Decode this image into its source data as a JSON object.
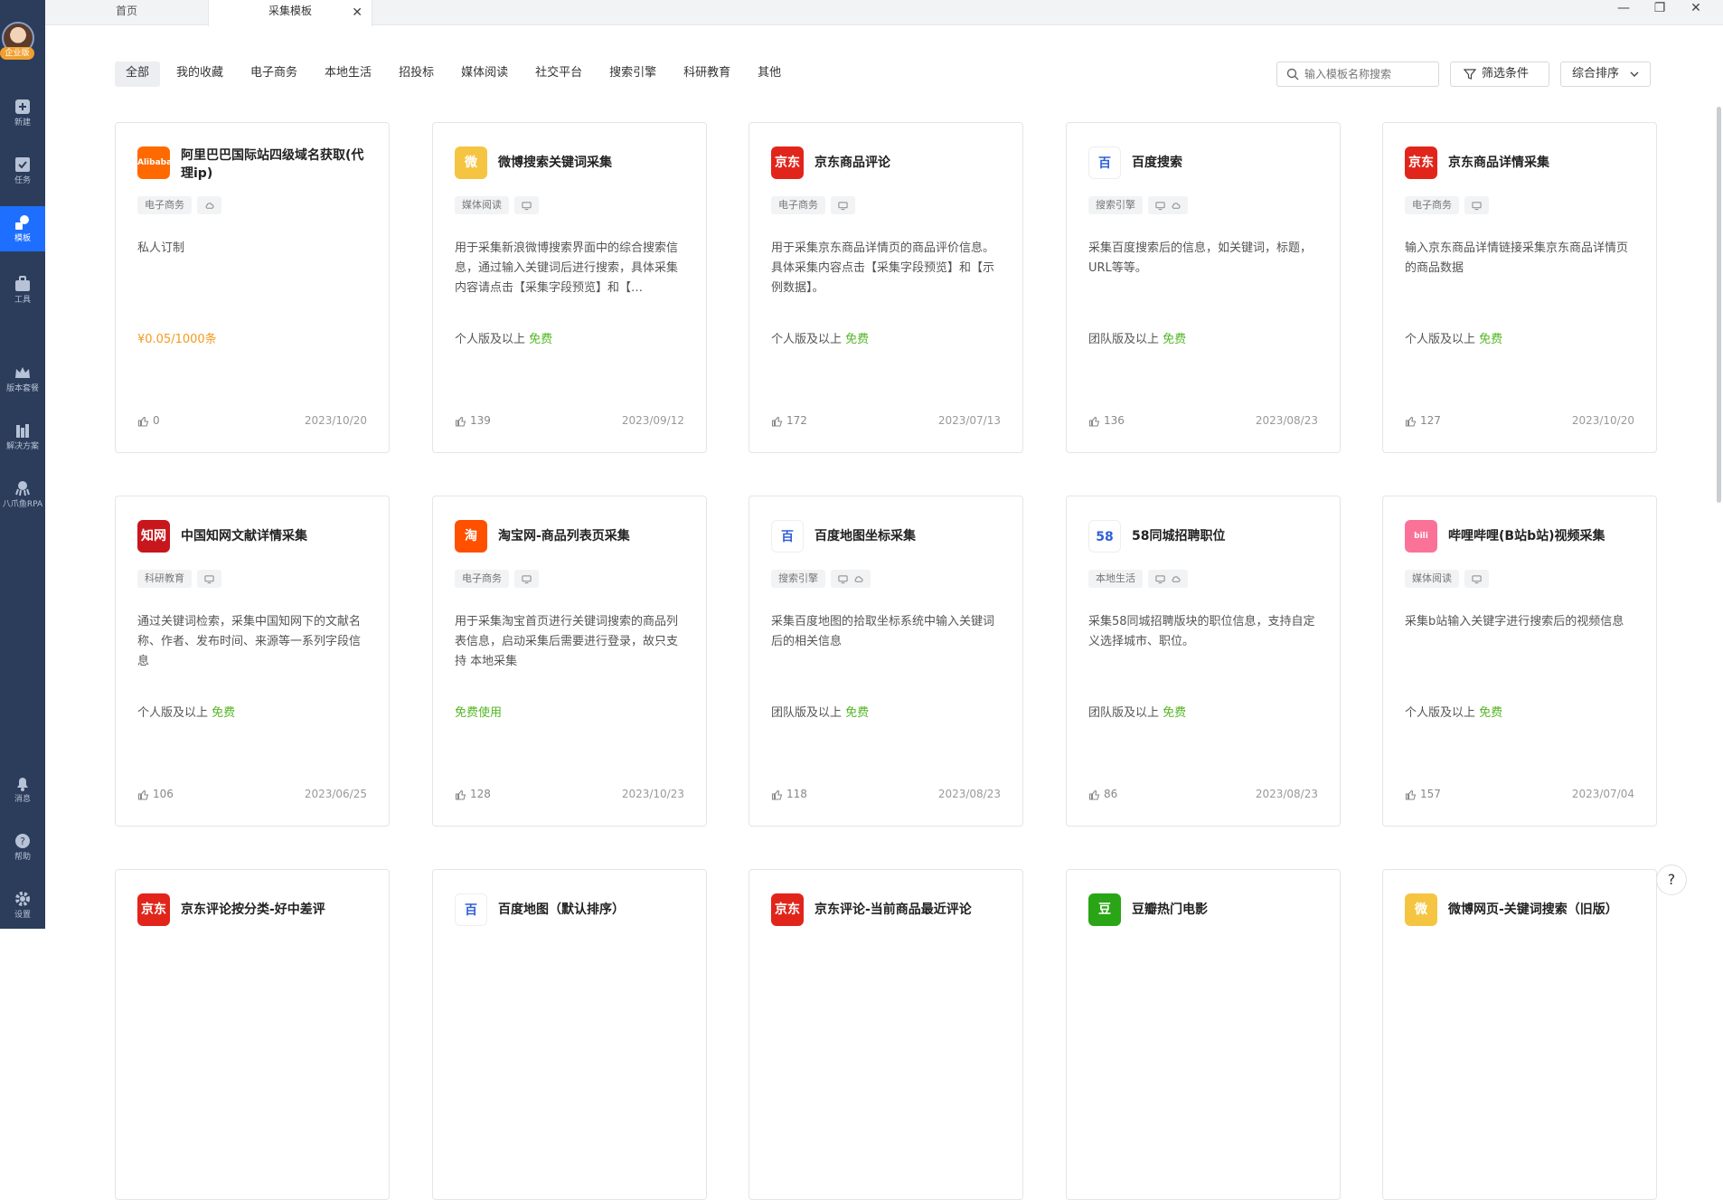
{
  "sidebar": {
    "vip_label": "企业版",
    "items": [
      {
        "label": "新建",
        "icon": "plus-square-icon"
      },
      {
        "label": "任务",
        "icon": "task-check-icon"
      },
      {
        "label": "模板",
        "icon": "template-icon",
        "active": true
      },
      {
        "label": "工具",
        "icon": "toolbox-icon"
      },
      {
        "label": "版本套餐",
        "icon": "crown-icon"
      },
      {
        "label": "解决方案",
        "icon": "solution-icon"
      },
      {
        "label": "八爪鱼RPA",
        "icon": "octopus-icon"
      },
      {
        "label": "消息",
        "icon": "bell-icon"
      },
      {
        "label": "帮助",
        "icon": "help-icon"
      },
      {
        "label": "设置",
        "icon": "gear-icon"
      }
    ]
  },
  "tabs": {
    "home": "首页",
    "active": "采集模板"
  },
  "filters": {
    "categories": [
      "全部",
      "我的收藏",
      "电子商务",
      "本地生活",
      "招投标",
      "媒体阅读",
      "社交平台",
      "搜索引擎",
      "科研教育",
      "其他"
    ],
    "search_placeholder": "输入模板名称搜索",
    "filter_label": "筛选条件",
    "sort_label": "综合排序"
  },
  "colors": {
    "sidebar_bg": "#2b3d5b",
    "accent": "#1e6fff",
    "free_green": "#52b623",
    "price_orange": "#f39a1e"
  },
  "cards": [
    {
      "title": "阿里巴巴国际站四级域名获取(代理ip)",
      "logo_text": "Alibaba",
      "logo_color": "#ff6a00",
      "tag": "电子商务",
      "modes": [
        "cloud"
      ],
      "desc": "私人订制",
      "price_prefix": "¥0.05/1000条",
      "price_free": "",
      "likes": "0",
      "date": "2023/10/20"
    },
    {
      "title": "微博搜索关键词采集",
      "logo_text": "微",
      "logo_color": "#f5c542",
      "tag": "媒体阅读",
      "modes": [
        "local"
      ],
      "desc": "用于采集新浪微博搜索界面中的综合搜索信息，通过输入关键词后进行搜索，具体采集内容请点击【采集字段预览】和【…",
      "price_prefix": "个人版及以上",
      "price_free": "免费",
      "likes": "139",
      "date": "2023/09/12"
    },
    {
      "title": "京东商品评论",
      "logo_text": "京东",
      "logo_color": "#e1251b",
      "tag": "电子商务",
      "modes": [
        "local"
      ],
      "desc": "用于采集京东商品详情页的商品评价信息。具体采集内容点击【采集字段预览】和【示例数据】。",
      "price_prefix": "个人版及以上",
      "price_free": "免费",
      "likes": "172",
      "date": "2023/07/13"
    },
    {
      "title": "百度搜索",
      "logo_text": "百",
      "logo_color": "#ffffff",
      "tag": "搜索引擎",
      "modes": [
        "local",
        "cloud"
      ],
      "desc": "采集百度搜索后的信息，如关键词，标题，URL等等。",
      "price_prefix": "团队版及以上",
      "price_free": "免费",
      "likes": "136",
      "date": "2023/08/23"
    },
    {
      "title": "京东商品详情采集",
      "logo_text": "京东",
      "logo_color": "#e1251b",
      "tag": "电子商务",
      "modes": [
        "local"
      ],
      "desc": "输入京东商品详情链接采集京东商品详情页的商品数据",
      "price_prefix": "个人版及以上",
      "price_free": "免费",
      "likes": "127",
      "date": "2023/10/20"
    },
    {
      "title": "中国知网文献详情采集",
      "logo_text": "知网",
      "logo_color": "#c8161d",
      "tag": "科研教育",
      "modes": [
        "local"
      ],
      "desc": "通过关键词检索，采集中国知网下的文献名称、作者、发布时间、来源等一系列字段信息",
      "price_prefix": "个人版及以上",
      "price_free": "免费",
      "likes": "106",
      "date": "2023/06/25"
    },
    {
      "title": "淘宝网-商品列表页采集",
      "logo_text": "淘",
      "logo_color": "#ff5000",
      "tag": "电子商务",
      "modes": [
        "local"
      ],
      "desc": "用于采集淘宝首页进行关键词搜索的商品列表信息，启动采集后需要进行登录，故只支持 本地采集",
      "price_prefix": "",
      "price_free": "免费使用",
      "likes": "128",
      "date": "2023/10/23"
    },
    {
      "title": "百度地图坐标采集",
      "logo_text": "百",
      "logo_color": "#ffffff",
      "tag": "搜索引擎",
      "modes": [
        "local",
        "cloud"
      ],
      "desc": "采集百度地图的拾取坐标系统中输入关键词后的相关信息",
      "price_prefix": "团队版及以上",
      "price_free": "免费",
      "likes": "118",
      "date": "2023/08/23"
    },
    {
      "title": "58同城招聘职位",
      "logo_text": "58",
      "logo_color": "#ffffff",
      "tag": "本地生活",
      "modes": [
        "local",
        "cloud"
      ],
      "desc": "采集58同城招聘版块的职位信息，支持自定义选择城市、职位。",
      "price_prefix": "团队版及以上",
      "price_free": "免费",
      "likes": "86",
      "date": "2023/08/23"
    },
    {
      "title": "哔哩哔哩(B站b站)视频采集",
      "logo_text": "bili",
      "logo_color": "#fb7299",
      "tag": "媒体阅读",
      "modes": [
        "local"
      ],
      "desc": "采集b站输入关键字进行搜索后的视频信息",
      "price_prefix": "个人版及以上",
      "price_free": "免费",
      "likes": "157",
      "date": "2023/07/04"
    },
    {
      "title": "京东评论按分类-好中差评",
      "logo_text": "京东",
      "logo_color": "#e1251b",
      "tag": "",
      "modes": [],
      "desc": "",
      "price_prefix": "",
      "price_free": "",
      "likes": "",
      "date": ""
    },
    {
      "title": "百度地图（默认排序）",
      "logo_text": "百",
      "logo_color": "#ffffff",
      "tag": "",
      "modes": [],
      "desc": "",
      "price_prefix": "",
      "price_free": "",
      "likes": "",
      "date": ""
    },
    {
      "title": "京东评论-当前商品最近评论",
      "logo_text": "京东",
      "logo_color": "#e1251b",
      "tag": "",
      "modes": [],
      "desc": "",
      "price_prefix": "",
      "price_free": "",
      "likes": "",
      "date": ""
    },
    {
      "title": "豆瓣热门电影",
      "logo_text": "豆",
      "logo_color": "#2aa515",
      "tag": "",
      "modes": [],
      "desc": "",
      "price_prefix": "",
      "price_free": "",
      "likes": "",
      "date": ""
    },
    {
      "title": "微博网页-关键词搜索（旧版）",
      "logo_text": "微",
      "logo_color": "#f5c542",
      "tag": "",
      "modes": [],
      "desc": "",
      "price_prefix": "",
      "price_free": "",
      "likes": "",
      "date": ""
    }
  ],
  "help_icon": "?"
}
